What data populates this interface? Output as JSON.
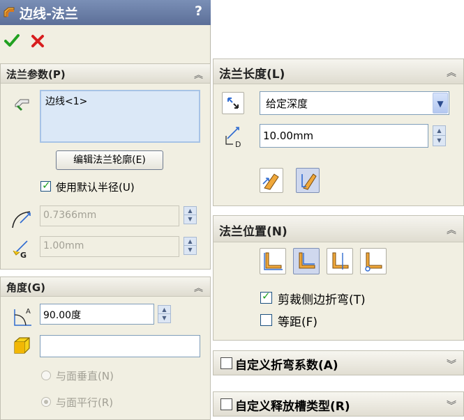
{
  "title": "边线-法兰",
  "help": "?",
  "actions": {
    "ok_icon": "checkmark-icon",
    "cancel_icon": "cross-icon"
  },
  "params": {
    "header": "法兰参数(P)",
    "edge_item": "边线<1>",
    "edit_profile_button": "编辑法兰轮廓(E)",
    "use_default_radius": {
      "label": "使用默认半径(U)",
      "checked": true
    },
    "radius_value": "0.7366mm",
    "gap_value": "1.00mm"
  },
  "angle": {
    "header": "角度(G)",
    "value": "90.00度",
    "face_field": "",
    "perpendicular_label": "与面垂直(N)",
    "parallel_label": "与面平行(R)"
  },
  "length": {
    "header": "法兰长度(L)",
    "end_condition": "给定深度",
    "depth_value": "10.00mm"
  },
  "position": {
    "header": "法兰位置(N)",
    "trim_side_bends": {
      "label": "剪裁侧边折弯(T)",
      "checked": true
    },
    "offset": {
      "label": "等距(F)",
      "checked": false
    }
  },
  "custom_bend_allowance": {
    "label": "自定义折弯系数(A)",
    "checked": false
  },
  "custom_relief_type": {
    "label": "自定义释放槽类型(R)",
    "checked": false
  },
  "colors": {
    "title_bar": "#5c6f98",
    "panel": "#f1efe2",
    "accent_check": "#21a121",
    "accent_cross": "#d81e1e"
  }
}
